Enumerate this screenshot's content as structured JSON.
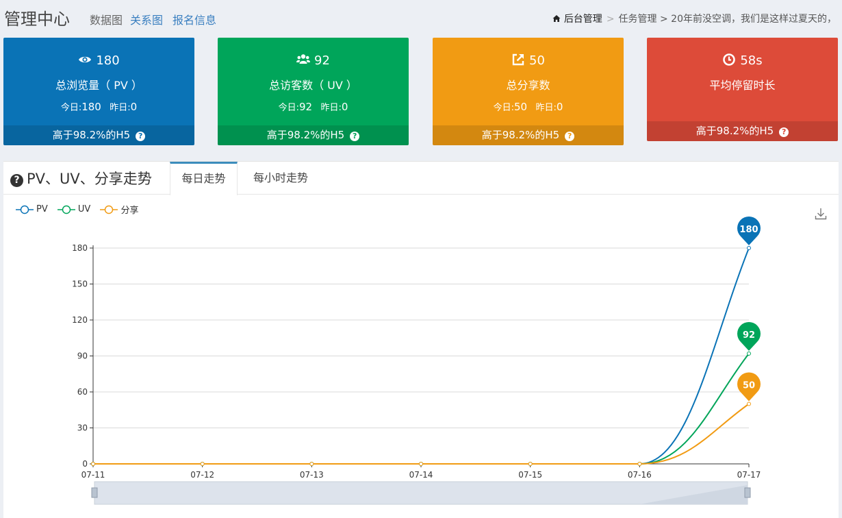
{
  "header": {
    "title": "管理中心",
    "links": [
      "数据图",
      "关系图",
      "报名信息"
    ],
    "breadcrumb": {
      "home": "后台管理",
      "sep": ">",
      "path": "任务管理 > 20年前没空调，我们是这样过夏天的，"
    }
  },
  "cards": [
    {
      "value": "180",
      "label": "总浏览量（ PV ）",
      "today_label": "今日:",
      "today": "180",
      "yesterday_label": "昨日:",
      "yesterday": "0",
      "foot": "高于98.2%的H5",
      "color": "#0a73b6",
      "icon": "eye-icon"
    },
    {
      "value": "92",
      "label": "总访客数（ UV ）",
      "today_label": "今日:",
      "today": "92",
      "yesterday_label": "昨日:",
      "yesterday": "0",
      "foot": "高于98.2%的H5",
      "color": "#00a55a",
      "icon": "users-icon"
    },
    {
      "value": "50",
      "label": "总分享数",
      "today_label": "今日:",
      "today": "50",
      "yesterday_label": "昨日:",
      "yesterday": "0",
      "foot": "高于98.2%的H5",
      "color": "#f19b13",
      "icon": "share-icon"
    },
    {
      "value": "58s",
      "label": "平均停留时长",
      "foot": "高于98.2%的H5",
      "color": "#dd4b39",
      "icon": "clock-icon"
    }
  ],
  "panel": {
    "title": "PV、UV、分享走势",
    "tabs": [
      "每日走势",
      "每小时走势"
    ]
  },
  "chart_data": {
    "type": "line",
    "x": [
      "07-11",
      "07-12",
      "07-13",
      "07-14",
      "07-15",
      "07-16",
      "07-17"
    ],
    "series": [
      {
        "name": "PV",
        "values": [
          0,
          0,
          0,
          0,
          0,
          0,
          180
        ],
        "color": "#0a73b6"
      },
      {
        "name": "UV",
        "values": [
          0,
          0,
          0,
          0,
          0,
          0,
          92
        ],
        "color": "#00a55a"
      },
      {
        "name": "分享",
        "values": [
          0,
          0,
          0,
          0,
          0,
          0,
          50
        ],
        "color": "#f19b13"
      }
    ],
    "ylim": [
      0,
      180
    ],
    "yticks": [
      0,
      30,
      60,
      90,
      120,
      150,
      180
    ],
    "smooth": true,
    "grid": true,
    "legend": "top-left",
    "markers": "max value pins",
    "datazoom": true
  }
}
